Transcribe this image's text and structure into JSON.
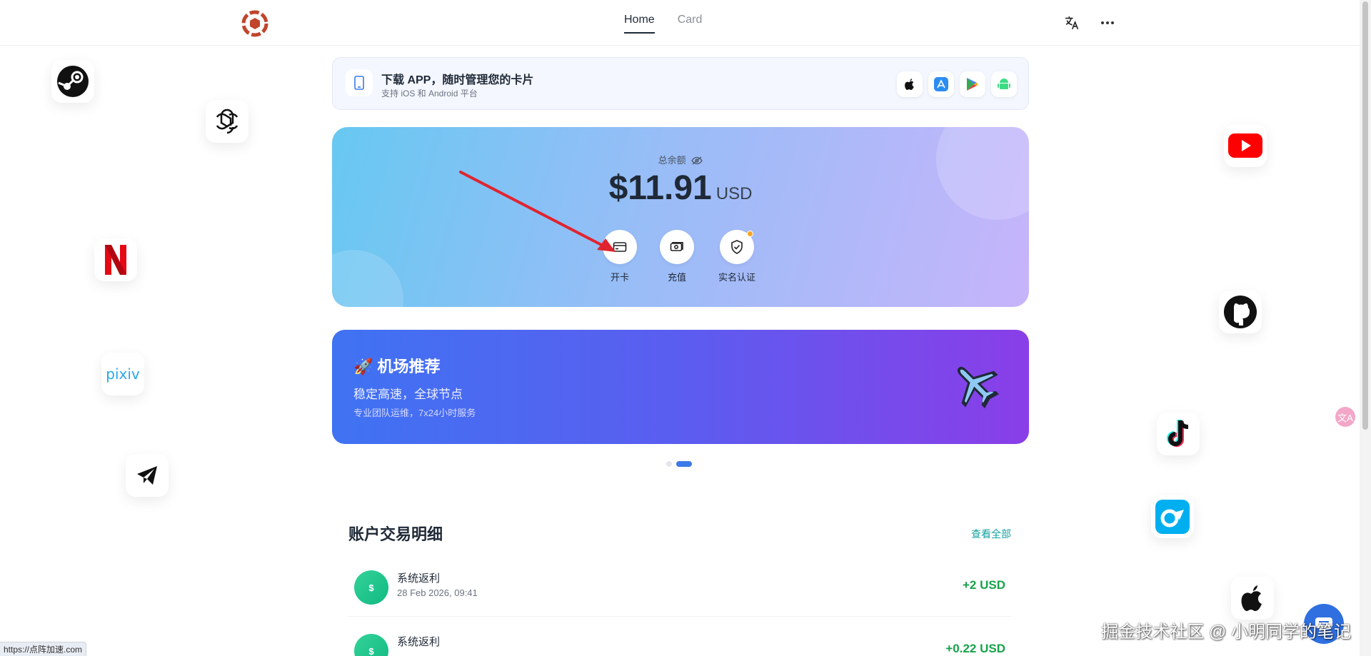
{
  "nav": {
    "home": "Home",
    "card": "Card"
  },
  "header": {
    "translate_icon": "translate-icon",
    "more_icon": "more-icon"
  },
  "download_banner": {
    "title": "下载 APP，随时管理您的卡片",
    "subtitle": "支持 iOS 和 Android 平台",
    "stores": [
      "apple-store-icon",
      "app-store-icon",
      "google-play-icon",
      "android-icon"
    ]
  },
  "balance": {
    "label": "总余额",
    "amount": "$11.91",
    "currency": "USD",
    "actions": [
      {
        "label": "开卡",
        "icon": "card-icon"
      },
      {
        "label": "充值",
        "icon": "recharge-icon"
      },
      {
        "label": "实名认证",
        "icon": "verify-shield-icon"
      }
    ],
    "verify_badge_color": "#f5a623"
  },
  "promo": {
    "title": "🚀 机场推荐",
    "subtitle": "稳定高速，全球节点",
    "detail": "专业团队运维，7x24小时服务",
    "icon": "airplane-icon"
  },
  "carousel": {
    "slides": 2,
    "active": 2
  },
  "transactions": {
    "title": "账户交易明细",
    "view_all": "查看全部",
    "rows": [
      {
        "icon_text": "$",
        "name": "系统返利",
        "date": "28 Feb 2026, 09:41",
        "amount": "+2 USD"
      },
      {
        "icon_text": "$",
        "name": "系统返利",
        "date": "",
        "amount": "+0.22 USD"
      }
    ]
  },
  "floating_icons": [
    "steam-icon",
    "openai-icon",
    "netflix-icon",
    "pixiv-icon",
    "telegram-icon",
    "youtube-icon",
    "github-icon",
    "tiktok-icon",
    "onlyfans-icon",
    "apple-icon"
  ],
  "pixiv_text": "pixiv",
  "status_url": "https://点阵加速.com",
  "watermark": "掘金技术社区 @ 小明同学的笔记",
  "translate_fab_text": "文A",
  "colors": {
    "accent": "#3b7ae8",
    "positive": "#16a34a",
    "link": "#14a1a0",
    "annotation_arrow": "#e0242f"
  }
}
